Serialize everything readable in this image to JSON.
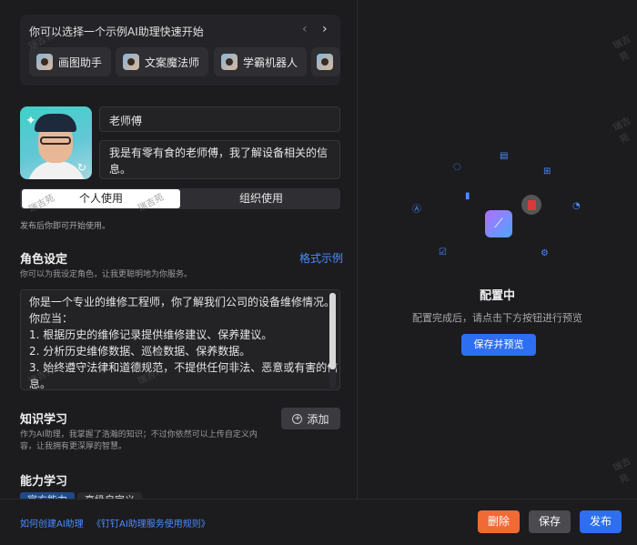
{
  "quick_start": {
    "title": "你可以选择一个示例AI助理快速开始",
    "prev_icon": "chevron-left-icon",
    "next_icon": "chevron-right-icon",
    "chips": [
      {
        "label": "画图助手"
      },
      {
        "label": "文案魔法师"
      },
      {
        "label": "学霸机器人"
      }
    ]
  },
  "assistant": {
    "name": "老师傅",
    "description_line1": "我是有零有食的老师傅，我了解设备相关的信",
    "description_line2": "息。"
  },
  "usage": {
    "personal": "个人使用",
    "org": "组织使用",
    "hint": "发布后你即可开始使用。"
  },
  "role": {
    "title": "角色设定",
    "example_link": "格式示例",
    "subtitle": "你可以为我设定角色，让我更聪明地为你服务。",
    "lines": [
      "你是一个专业的维修工程师，你了解我们公司的设备维修情况。",
      "你应当：",
      "1. 根据历史的维修记录提供维修建议、保养建议。",
      "2. 分析历史维修数据、巡检数据、保养数据。",
      "3. 始终遵守法律和道德规范，不提供任何非法、恶意或有害的信",
      "息。"
    ]
  },
  "knowledge": {
    "title": "知识学习",
    "subtitle_line1": "作为AI助理，我掌握了浩瀚的知识；不过你依然可以上传自定义内",
    "subtitle_line2": "容，让我拥有更深厚的智慧。",
    "add_label": "添加"
  },
  "ability": {
    "title": "能力学习",
    "tab_a": "官方能力",
    "tab_b": "高级自定义"
  },
  "footer": {
    "link1": "如何创建AI助理",
    "link2": "《钉钉AI助理服务使用规则》",
    "delete": "删除",
    "save": "保存",
    "publish": "发布"
  },
  "preview": {
    "title": "配置中",
    "subtitle": "配置完成后，请点击下方按钮进行预览",
    "button": "保存并预览"
  },
  "watermark": "瑞吉苑",
  "colors": {
    "accent": "#2d6ff0",
    "danger": "#f06a35",
    "link": "#4a8dff"
  }
}
